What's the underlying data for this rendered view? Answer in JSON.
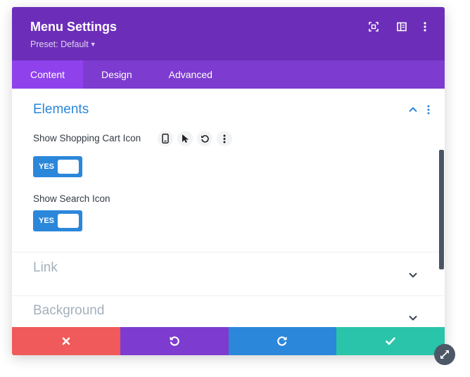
{
  "header": {
    "title": "Menu Settings",
    "preset_label": "Preset: Default",
    "icons": [
      "fullscreen-icon",
      "split-view-icon",
      "more-options-icon"
    ]
  },
  "tabs": [
    {
      "label": "Content",
      "active": true
    },
    {
      "label": "Design",
      "active": false
    },
    {
      "label": "Advanced",
      "active": false
    }
  ],
  "sections": {
    "elements": {
      "title": "Elements",
      "expanded": true,
      "options": [
        {
          "label": "Show Shopping Cart Icon",
          "toggle": "YES",
          "value": true
        },
        {
          "label": "Show Search Icon",
          "toggle": "YES",
          "value": true
        }
      ],
      "option_icons": [
        "phone-icon",
        "cursor-icon",
        "reset-icon",
        "more-icon"
      ]
    },
    "link": {
      "title": "Link",
      "expanded": false
    },
    "background": {
      "title": "Background",
      "expanded": false
    }
  },
  "footer": {
    "buttons": [
      "close-icon",
      "undo-icon",
      "redo-icon",
      "check-icon"
    ]
  },
  "colors": {
    "header": "#6c2eb9",
    "tabs": "#7d3bcf",
    "active_tab": "#8f42ec",
    "accent_blue": "#2b87da",
    "cancel_red": "#f05a5a",
    "undo_purple": "#7d3bcf",
    "redo_blue": "#2b87da",
    "save_green": "#29c4a9"
  }
}
